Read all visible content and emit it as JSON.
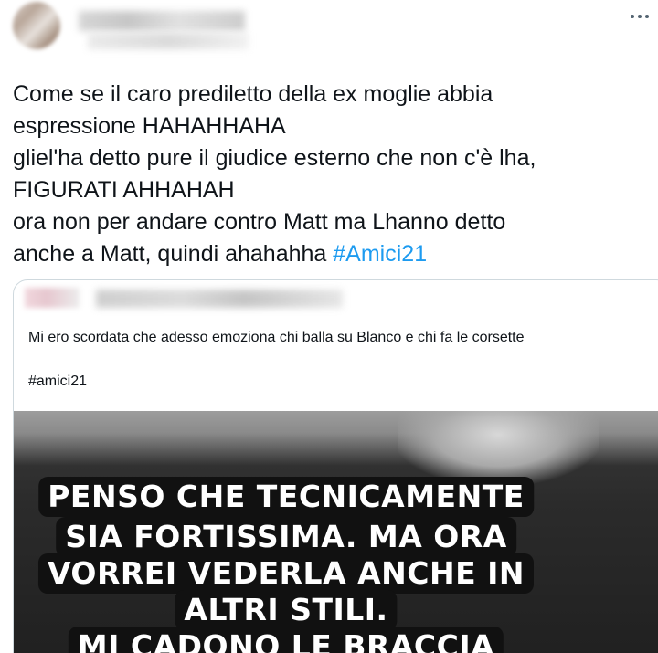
{
  "header": {
    "more_icon": "more-horizontal-icon"
  },
  "tweet": {
    "text_lines": [
      "Come se il caro prediletto della ex moglie abbia",
      "espressione HAHAHHAHA",
      "gliel'ha detto pure il giudice esterno che non c'è lha,",
      "FIGURATI AHHAHAH",
      "ora non per andare contro Matt ma Lhanno detto",
      "anche a Matt, quindi ahahahha "
    ],
    "hashtag": "#Amici21",
    "hashtag_color": "#1d9bf0"
  },
  "quote": {
    "text": "Mi ero scordata che adesso emoziona chi balla su Blanco e chi fa le corsette",
    "hashtag": "#amici21",
    "image_caption_lines": [
      "PENSO CHE TECNICAMENTE",
      "SIA FORTISSIMA. MA ORA",
      "VORREI VEDERLA ANCHE IN",
      "ALTRI STILI.",
      "MI CADONO LE BRACCIA"
    ]
  }
}
